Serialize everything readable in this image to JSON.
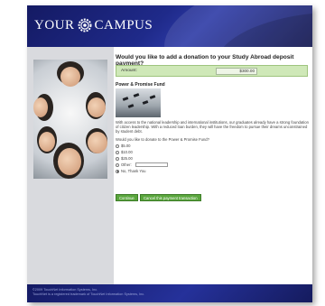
{
  "brand": {
    "logo_left": "YOUR",
    "logo_right": "CAMPUS"
  },
  "donation": {
    "question": "Would you like to add a donation to your Study Abroad deposit payment?",
    "amount_label": "Amount:",
    "amount_value": "$300.00"
  },
  "fund": {
    "title": "Power & Promise Fund",
    "description": "With access to the national leadership and international institutions, our graduates already have a strong foundation of citizen leadership. With a reduced loan burden, they will have the freedom to pursue their dreams unconstrained by student debt.",
    "ask": "Would you like to donate to the Power & Promise Fund?",
    "options": [
      "$5.00",
      "$10.00",
      "$25.00",
      "Other:",
      "No, Thank You"
    ],
    "selected_option": "No, Thank You"
  },
  "buttons": {
    "continue": "Continue",
    "cancel": "Cancel this payment transaction"
  },
  "footer": {
    "line1": "©2009 TouchNet Information Systems, Inc.",
    "line2": "TouchNet is a registered trademark of TouchNet Information Systems, Inc."
  },
  "colors": {
    "header": "#1f2a8a",
    "amount_bar": "#cfe8b8",
    "button": "#5aa63d"
  }
}
